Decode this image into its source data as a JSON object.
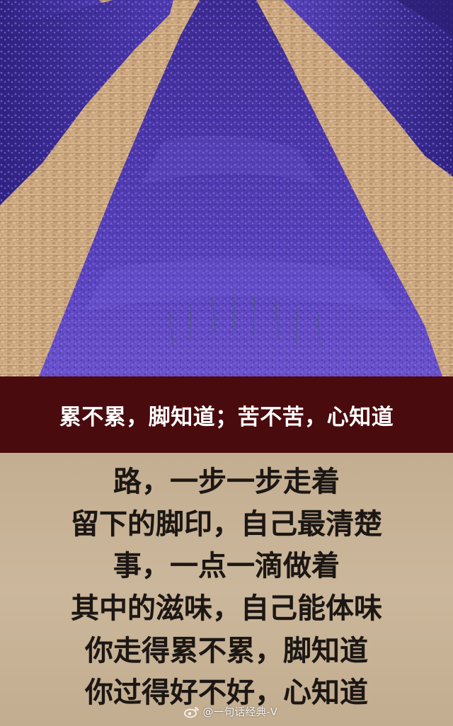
{
  "title": "累不累，脚知道；苦不苦，心知道",
  "poem": {
    "lines": [
      "路，一步一步走着",
      "留下的脚印，自己最清楚",
      "事，一点一滴做着",
      "其中的滋味，自己能体味",
      "你走得累不累，脚知道",
      "你过得好不好，心知道"
    ]
  },
  "watermark": {
    "icon": "weibo-icon",
    "handle": "@一句话经典-V"
  },
  "colors": {
    "title_band": "#4a0b0e",
    "title_text": "#ffffff",
    "poem_background": "#c8b397",
    "poem_text": "#1c1714",
    "lavender": "#5a3fb8",
    "soil": "#c9a67c"
  }
}
